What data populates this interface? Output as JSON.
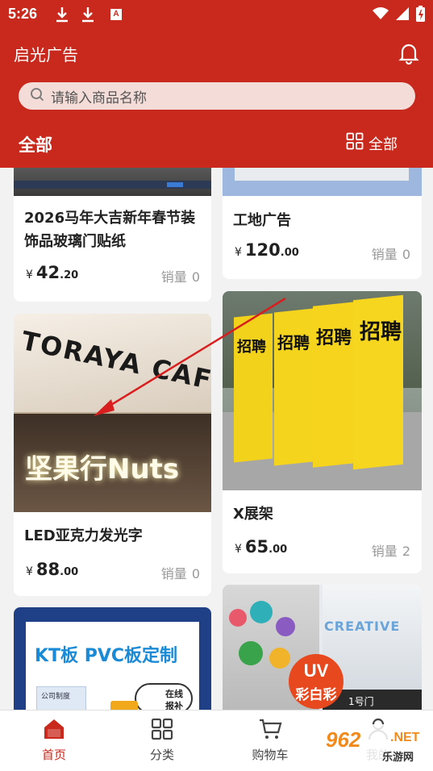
{
  "status": {
    "time": "5:26",
    "a_icon": "A"
  },
  "header": {
    "title": "启光广告",
    "search_placeholder": "请输入商品名称",
    "cat_left": "全部",
    "cat_right": "全部"
  },
  "products": [
    {
      "name_line1": "2026马年大吉新年春节装",
      "name_line2": "饰品玻璃门贴纸",
      "currency": "¥",
      "price_int": "42",
      "price_dec": ".20",
      "sales_label": "销量",
      "sales": "0"
    },
    {
      "name": "工地广告",
      "currency": "¥",
      "price_int": "120",
      "price_dec": ".00",
      "sales_label": "销量",
      "sales": "0"
    },
    {
      "name": "LED亚克力发光字",
      "currency": "¥",
      "price_int": "88",
      "price_dec": ".00",
      "sales_label": "销量",
      "sales": "0",
      "image_text_top": "TORAYA CAFE",
      "image_text_bottom": "坚果行Nuts"
    },
    {
      "name": "X展架",
      "currency": "¥",
      "price_int": "65",
      "price_dec": ".00",
      "sales_label": "销量",
      "sales": "2",
      "image_text": "招聘"
    },
    {
      "image_text": "KT板 PVC板定制",
      "image_sub1": "公司制度",
      "image_sub2": "在线",
      "image_sub3": "报补"
    },
    {
      "image_text_badge1": "UV",
      "image_text_badge2": "彩白彩",
      "image_text_sign": "CREATIVE",
      "image_text_door": "1号门"
    }
  ],
  "tabs": [
    {
      "label": "首页",
      "icon": "home-icon"
    },
    {
      "label": "分类",
      "icon": "grid-icon"
    },
    {
      "label": "购物车",
      "icon": "cart-icon"
    },
    {
      "label": "我的",
      "icon": "user-icon"
    }
  ],
  "watermark": {
    "big": "962",
    "net": ".NET",
    "sub": "乐游网"
  },
  "colors": {
    "primary": "#c8291c",
    "search_bg": "#f4dcd8"
  }
}
